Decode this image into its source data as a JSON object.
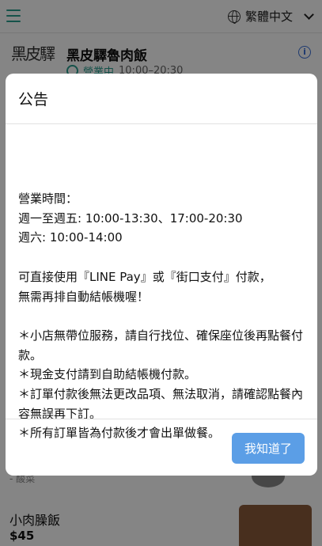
{
  "app": {
    "language": "繁體中文"
  },
  "store": {
    "name": "黑皮驛魯肉飯",
    "status": "營業中",
    "hours": "10:00–20:30",
    "logo_text": "黑皮驛"
  },
  "menu": {
    "partial_text": "- 酸菜",
    "item_name": "小肉臊飯",
    "item_price": "$45"
  },
  "modal": {
    "title": "公告",
    "lines": [
      "營業時間：",
      "週一至週五: 10:00-13:30、17:00-20:30",
      "週六: 10:00-14:00",
      "",
      "可直接使用『LINE Pay』或『街口支付』付款，",
      "無需再排自動結帳機喔！",
      "",
      "＊小店無帶位服務，請自行找位、確保座位後再點餐付款。",
      "＊現金支付請到自助結帳機付款。",
      "＊訂單付款後無法更改品項、無法取消，請確認點餐內容無誤再下訂。",
      "＊所有訂單皆為付款後才會出單做餐。"
    ],
    "confirm_label": "我知道了"
  },
  "colors": {
    "accent": "#2a9d8f",
    "button": "#5b9ee6",
    "info": "#3b6fd6"
  },
  "icons": [
    "hamburger-icon",
    "globe-icon",
    "chevron-down-icon",
    "clock-icon",
    "info-icon"
  ]
}
